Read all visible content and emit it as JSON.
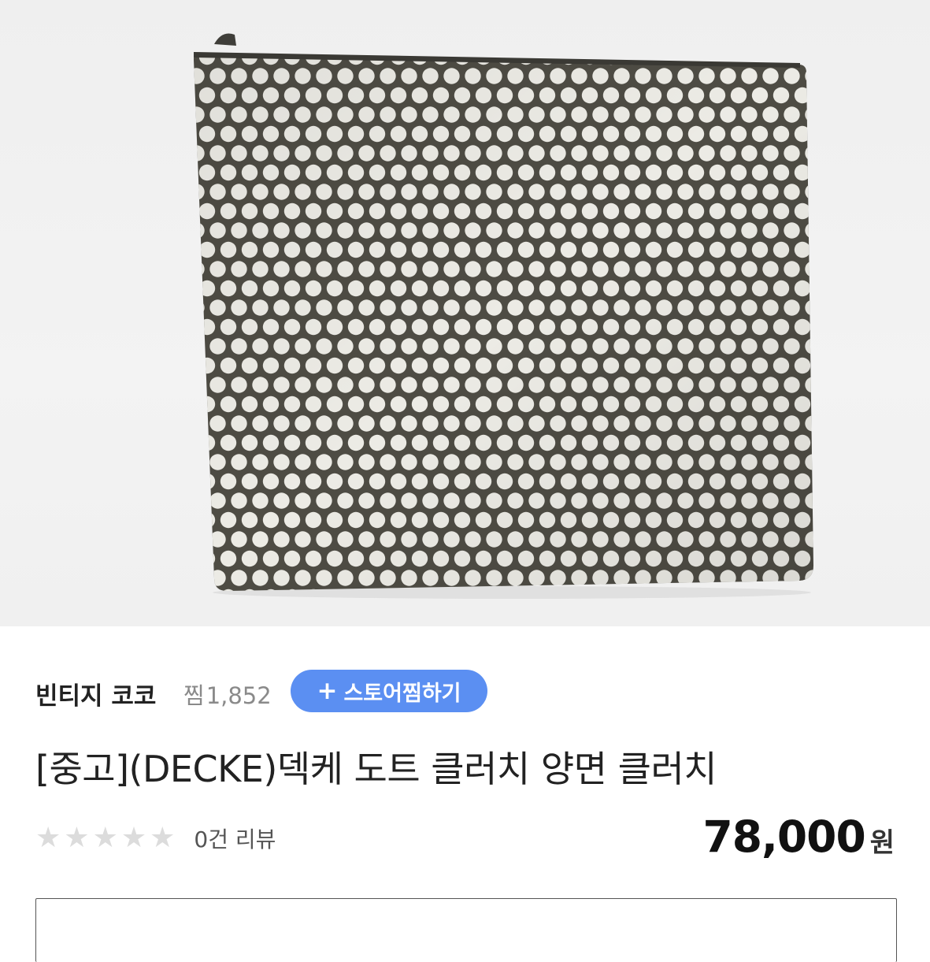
{
  "product_image": {
    "description_icon": "polka-dot-clutch-image"
  },
  "store": {
    "name": "빈티지 코코",
    "fav_prefix": "찜",
    "fav_count": "1,852",
    "follow_button_label": "스토어찜하기",
    "follow_button_icon": "plus-icon"
  },
  "product": {
    "title": "[중고](DECKE)덱케 도트 클러치 양면 클러치",
    "rating_stars": 0,
    "rating_max": 5,
    "review_text": "0건 리뷰",
    "price": "78,000",
    "price_unit": "원"
  },
  "colors": {
    "accent": "#5b8ff2",
    "clutch_dark": "#4e4c44",
    "dot": "#ecebe5"
  }
}
